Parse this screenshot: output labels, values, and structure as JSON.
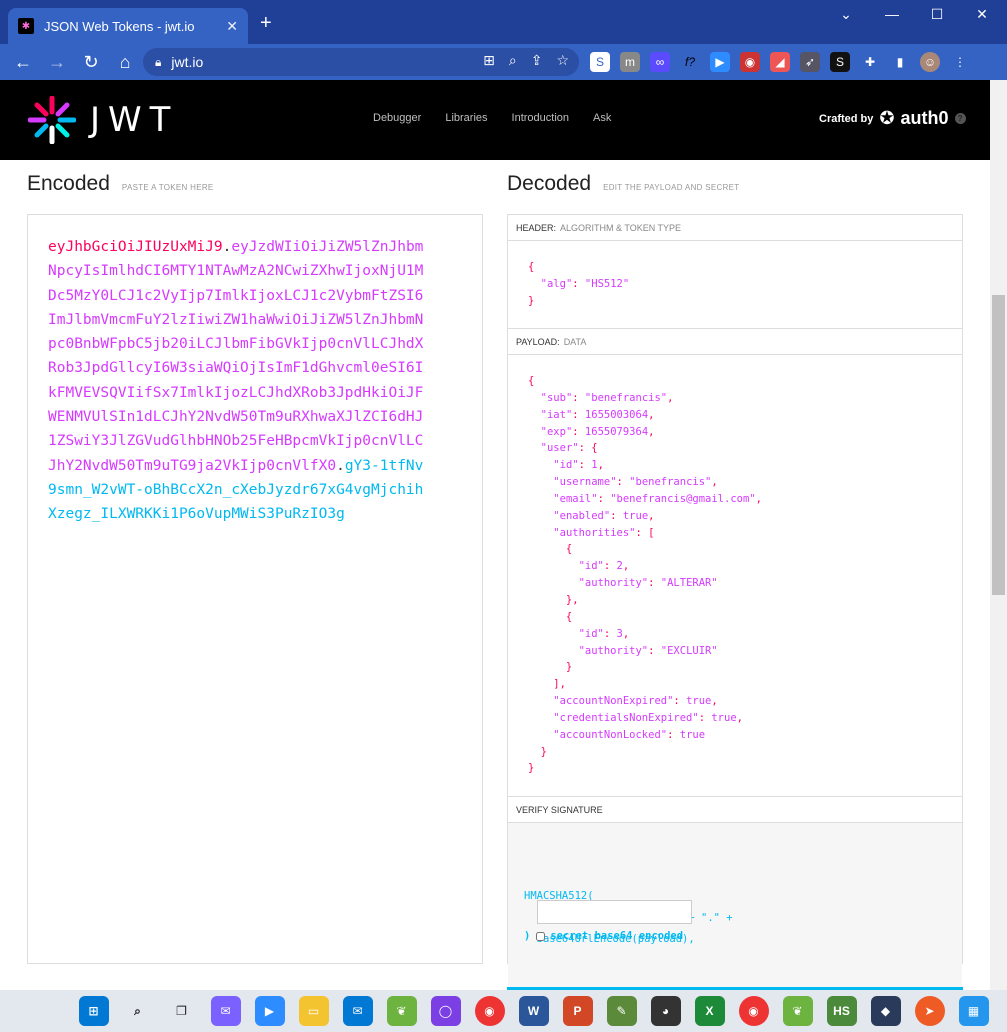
{
  "browser": {
    "tab_title": "JSON Web Tokens - jwt.io",
    "url": "jwt.io",
    "controls": {
      "minimize": "—",
      "maximize": "☐",
      "close": "✕",
      "dropdown": "⌄",
      "newtab": "+"
    }
  },
  "site": {
    "logo_text": "JWT",
    "nav": [
      "Debugger",
      "Libraries",
      "Introduction",
      "Ask"
    ],
    "crafted_by": "Crafted by",
    "crafted_brand": "auth0"
  },
  "encoded": {
    "title": "Encoded",
    "subtitle": "PASTE A TOKEN HERE",
    "token_header": "eyJhbGciOiJIUzUxMiJ9",
    "token_payload": "eyJzdWIiOiJiZW5lZnJhbmNpcyIsImlhdCI6MTY1NTAwMzA2NCwiZXhwIjoxNjU1MDc5MzY0LCJ1c2VyIjp7ImlkIjoxLCJ1c2VybmFtZSI6ImJlbmVmcmFuY2lzIiwiZW1haWwiOiJiZW5lZnJhbmNpc0BnbWFpbC5jb20iLCJlbmFibGVkIjp0cnVlLCJhdXRob3JpdGllcyI6W3siaWQiOjIsImF1dGhvcml0eSI6IkFMVEVSQVIifSx7ImlkIjozLCJhdXRob3JpdHkiOiJFWENMVUlSIn1dLCJhY2NvdW50Tm9uRXhwaXJlZCI6dHJ1ZSwiY3JlZGVudGlhbHNOb25FeHBpcmVkIjp0cnVlLCJhY2NvdW50Tm9uTG9ja2VkIjp0cnVlfX0",
    "token_signature": "gY3-1tfNv9smn_W2vWT-oBhBCcX2n_cXebJyzdr67xG4vgMjchihXzegz_ILXWRKKi1P6oVupMWiS3PuRzIO3g",
    "dot": "."
  },
  "decoded": {
    "title": "Decoded",
    "subtitle": "EDIT THE PAYLOAD AND SECRET",
    "header_label": "HEADER:",
    "header_sub": "ALGORITHM & TOKEN TYPE",
    "header_json": "{\n  \"alg\": \"HS512\"\n}",
    "payload_label": "PAYLOAD:",
    "payload_sub": "DATA",
    "payload_json": "{\n  \"sub\": \"benefrancis\",\n  \"iat\": 1655003064,\n  \"exp\": 1655079364,\n  \"user\": {\n    \"id\": 1,\n    \"username\": \"benefrancis\",\n    \"email\": \"benefrancis@gmail.com\",\n    \"enabled\": true,\n    \"authorities\": [\n      {\n        \"id\": 2,\n        \"authority\": \"ALTERAR\"\n      },\n      {\n        \"id\": 3,\n        \"authority\": \"EXCLUIR\"\n      }\n    ],\n    \"accountNonExpired\": true,\n    \"credentialsNonExpired\": true,\n    \"accountNonLocked\": true\n  }\n}",
    "verify_label": "VERIFY SIGNATURE",
    "verify_code": "HMACSHA512(\n  base64UrlEncode(header) + \".\" +\n  base64UrlEncode(payload),",
    "verify_close": ")",
    "secret_base64_label": "secret base64 encoded",
    "secret_value": ""
  },
  "colors": {
    "header": "#fb015b",
    "payload": "#d63aff",
    "signature": "#00b9f1"
  },
  "taskbar": [
    "windows-icon",
    "search-icon",
    "task-view-icon",
    "teams-icon",
    "zoom-icon",
    "file-explorer-icon",
    "mail-icon",
    "spring-icon",
    "app-circle-icon",
    "chrome-icon",
    "word-icon",
    "powerpoint-icon",
    "app-green-icon",
    "github-icon",
    "excel-icon",
    "chrome-profile-icon",
    "spring2-icon",
    "hs-icon",
    "app-dark-icon",
    "postman-icon",
    "docker-icon"
  ]
}
